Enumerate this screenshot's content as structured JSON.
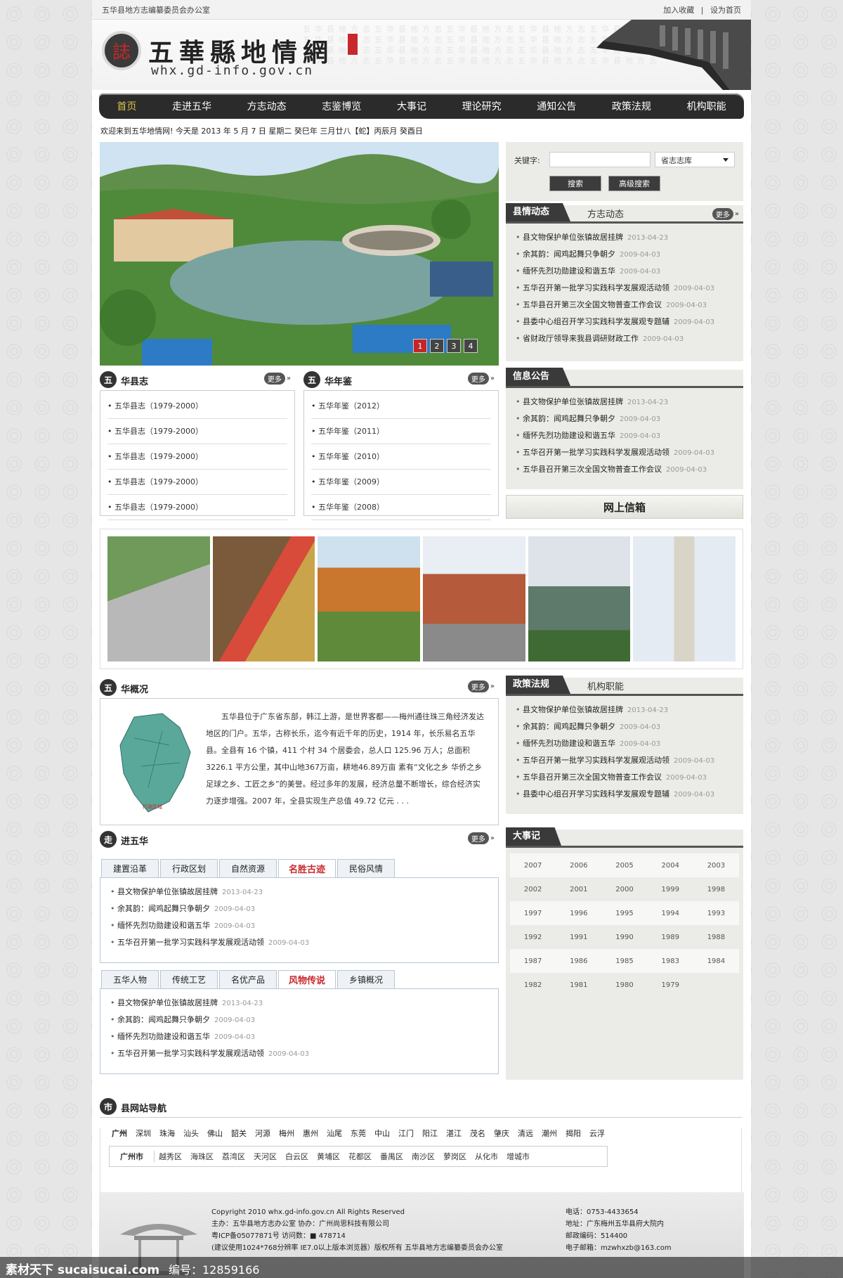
{
  "topbar": {
    "org": "五华县地方志编纂委员会办公室",
    "bookmark": "加入收藏",
    "sep": "|",
    "homepage": "设为首页"
  },
  "logo": {
    "seal": "誌",
    "title": "五華縣地情網",
    "url": "whx.gd-info.gov.cn",
    "stamp": "印章"
  },
  "banner": {
    "bgtext": "五华县地方志五华县地方志五华县地方志五华县地方志五华县地方志五华县地方志五华县地方志五华县地方志五华县地方志五华县地方志五华县地方志五华县地方志五华县地方志五华县地方志五华县地方志五华县地方志五华县地方志五华县地方志五华县地方志五华县地方志"
  },
  "nav": [
    "首页",
    "走进五华",
    "方志动态",
    "志鉴博览",
    "大事记",
    "理论研究",
    "通知公告",
    "政策法规",
    "机构职能"
  ],
  "welcome": "欢迎来到五华地情网!   今天是 2013 年 5 月 7 日 星期二   癸巳年 三月廿八【蛇】丙辰月 癸酉日",
  "hero": {
    "dots": [
      "1",
      "2",
      "3",
      "4"
    ]
  },
  "search": {
    "label": "关键字:",
    "select": "省志志库",
    "btn1": "搜索",
    "btn2": "高级搜索"
  },
  "county": {
    "tab1": "县情动态",
    "tab2": "方志动态",
    "more": "更多",
    "items": [
      [
        "县文物保护单位张镇故居挂牌",
        "2013-04-23"
      ],
      [
        "余其韵：闻鸡起舞只争朝夕",
        "2009-04-03"
      ],
      [
        "缅怀先烈功勋建设和谐五华",
        "2009-04-03"
      ],
      [
        "五华召开第一批学习实践科学发展观活动领",
        "2009-04-03"
      ],
      [
        "五华县召开第三次全国文物普查工作会议",
        "2009-04-03"
      ],
      [
        "县委中心组召开学习实践科学发展观专题辅",
        "2009-04-03"
      ],
      [
        "省财政厅领导来我县调研财政工作",
        "2009-04-03"
      ]
    ]
  },
  "huaxianzhi": {
    "icon": "五",
    "title": "华县志",
    "more": "更多",
    "items": [
      "五华县志（1979-2000）",
      "五华县志（1979-2000）",
      "五华县志（1979-2000）",
      "五华县志（1979-2000）",
      "五华县志（1979-2000）"
    ]
  },
  "huanianjian": {
    "icon": "五",
    "title": "华年鉴",
    "more": "更多",
    "items": [
      "五华年鉴（2012）",
      "五华年鉴（2011）",
      "五华年鉴（2010）",
      "五华年鉴（2009）",
      "五华年鉴（2008）"
    ]
  },
  "notice": {
    "tab1": "信息公告",
    "items": [
      [
        "县文物保护单位张镇故居挂牌",
        "2013-04-23"
      ],
      [
        "余其韵：闻鸡起舞只争朝夕",
        "2009-04-03"
      ],
      [
        "缅怀先烈功勋建设和谐五华",
        "2009-04-03"
      ],
      [
        "五华召开第一批学习实践科学发展观活动领",
        "2009-04-03"
      ],
      [
        "五华县召开第三次全国文物普查工作会议",
        "2009-04-03"
      ]
    ]
  },
  "mailbox": "网上信箱",
  "overview": {
    "icon": "五",
    "title": "华概况",
    "more": "更多",
    "map_label": "行政区域",
    "text": "五华县位于广东省东部，韩江上游，是世界客都——梅州通往珠三角经济发达地区的门户。五华，古称长乐，迄今有近千年的历史，1914 年，长乐易名五华县。全县有 16 个镇，411 个村 34 个居委会，总人口 125.96 万人；总面积 3226.1 平方公里，其中山地367万亩，耕地46.89万亩 素有“文化之乡 华侨之乡 足球之乡、工匠之乡”的美誉。经过多年的发展，经济总量不断增长，综合经济实力逐步增强。2007 年，全县实现生产总值 49.72 亿元 . . ."
  },
  "policy": {
    "tab1": "政策法规",
    "tab2": "机构职能",
    "items": [
      [
        "县文物保护单位张镇故居挂牌",
        "2013-04-23"
      ],
      [
        "余其韵：闻鸡起舞只争朝夕",
        "2009-04-03"
      ],
      [
        "缅怀先烈功勋建设和谐五华",
        "2009-04-03"
      ],
      [
        "五华召开第一批学习实践科学发展观活动领",
        "2009-04-03"
      ],
      [
        "五华县召开第三次全国文物普查工作会议",
        "2009-04-03"
      ],
      [
        "县委中心组召开学习实践科学发展观专题辅",
        "2009-04-03"
      ]
    ]
  },
  "enter": {
    "icon": "走",
    "title": "进五华",
    "more": "更多",
    "tabs1": [
      "建置沿革",
      "行政区划",
      "自然资源",
      "名胜古迹",
      "民俗风情"
    ],
    "tabs2": [
      "五华人物",
      "传统工艺",
      "名优产品",
      "风物传说",
      "乡镇概况"
    ],
    "items": [
      [
        "县文物保护单位张镇故居挂牌",
        "2013-04-23"
      ],
      [
        "余其韵：闻鸡起舞只争朝夕",
        "2009-04-03"
      ],
      [
        "缅怀先烈功勋建设和谐五华",
        "2009-04-03"
      ],
      [
        "五华召开第一批学习实践科学发展观活动领",
        "2009-04-03"
      ]
    ]
  },
  "events": {
    "tab1": "大事记",
    "rows": [
      [
        "2007",
        "2006",
        "2005",
        "2004",
        "2003"
      ],
      [
        "2002",
        "2001",
        "2000",
        "1999",
        "1998"
      ],
      [
        "1997",
        "1996",
        "1995",
        "1994",
        "1993"
      ],
      [
        "1992",
        "1991",
        "1990",
        "1989",
        "1988"
      ],
      [
        "1987",
        "1986",
        "1985",
        "1983",
        "1984"
      ],
      [
        "1982",
        "1981",
        "1980",
        "1979",
        ""
      ]
    ]
  },
  "citynav": {
    "icon": "市",
    "title": "县网站导航",
    "cities": [
      "广州",
      "深圳",
      "珠海",
      "汕头",
      "佛山",
      "韶关",
      "河源",
      "梅州",
      "惠州",
      "汕尾",
      "东莞",
      "中山",
      "江门",
      "阳江",
      "湛江",
      "茂名",
      "肇庆",
      "清远",
      "潮州",
      "揭阳",
      "云浮"
    ],
    "district_label": "广州市",
    "districts": [
      "越秀区",
      "海珠区",
      "荔湾区",
      "天河区",
      "白云区",
      "黄埔区",
      "花都区",
      "番禺区",
      "南沙区",
      "萝岗区",
      "从化市",
      "增城市"
    ]
  },
  "footer": {
    "l1": "Copyright 2010 whx.gd-info.gov.cn  All Rights Reserved",
    "l2": "主办：五华县地方志办公室          协办：广州尚思科技有限公司",
    "l3": "粤ICP备05077871号          访问数：■ 478714",
    "l4": "(建议使用1024*768分辨率 IE7.0以上版本浏览器）版权所有 五华县地方志编纂委员会办公室",
    "r1": "电话：0753-4433654",
    "r2": "地址：广东梅州五华县府大院内",
    "r3": "邮政编码：514400",
    "r4": "电子邮箱：mzwhxzb@163.com"
  },
  "watermark": {
    "left": "素材天下 sucaisucai.com",
    "right": "编号：12859166"
  },
  "colors": {
    "nav_bg": "#2b2b2b",
    "nav_active": "#d8c24a",
    "accent_red": "#c3262a",
    "panel_gray": "#ebebe7"
  }
}
